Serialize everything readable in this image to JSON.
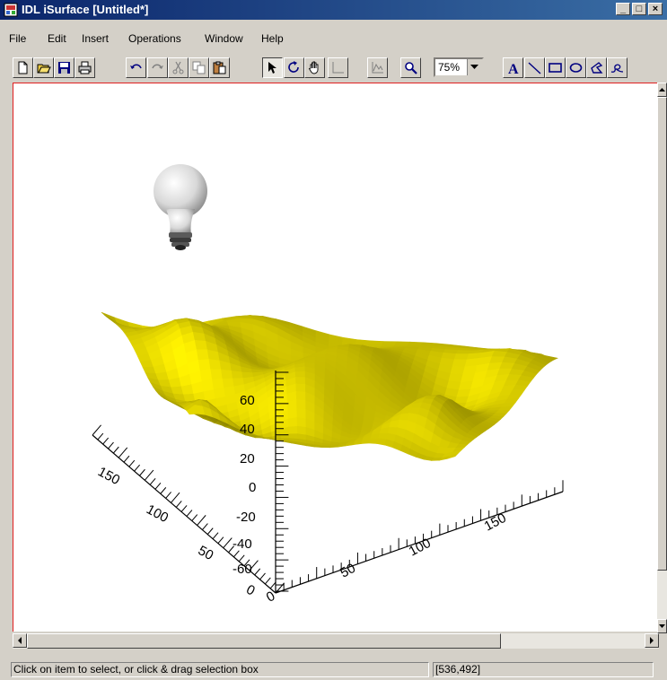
{
  "window": {
    "title": "IDL iSurface [Untitled*]",
    "controls": {
      "minimize": "_",
      "maximize": "□",
      "close": "×"
    }
  },
  "menu": {
    "items": [
      "File",
      "Edit",
      "Insert",
      "Operations",
      "Window",
      "Help"
    ]
  },
  "toolbar": {
    "icons": [
      "new-icon",
      "open-icon",
      "save-icon",
      "print-icon",
      "undo-icon",
      "redo-icon",
      "cut-icon",
      "copy-icon",
      "paste-icon",
      "select-arrow-icon",
      "rotate-icon",
      "pan-hand-icon",
      "line-profile-icon",
      "plot-profile-icon",
      "zoom-magnifier-icon",
      "text-icon",
      "line-tool-icon",
      "rectangle-tool-icon",
      "oval-tool-icon",
      "polygon-tool-icon",
      "freehand-tool-icon"
    ],
    "zoom_value": "75%",
    "text_tool_glyph": "A"
  },
  "surface": {
    "color": "#f2e400",
    "z_ticks": [
      "60",
      "40",
      "20",
      "0",
      "-20",
      "-40",
      "-60"
    ],
    "y_ticks": [
      "150",
      "100",
      "50",
      "0"
    ],
    "x_ticks": [
      "0",
      "50",
      "100",
      "150"
    ]
  },
  "status": {
    "message": "Click on item to select, or click & drag selection box",
    "coords": "[536,492]"
  }
}
